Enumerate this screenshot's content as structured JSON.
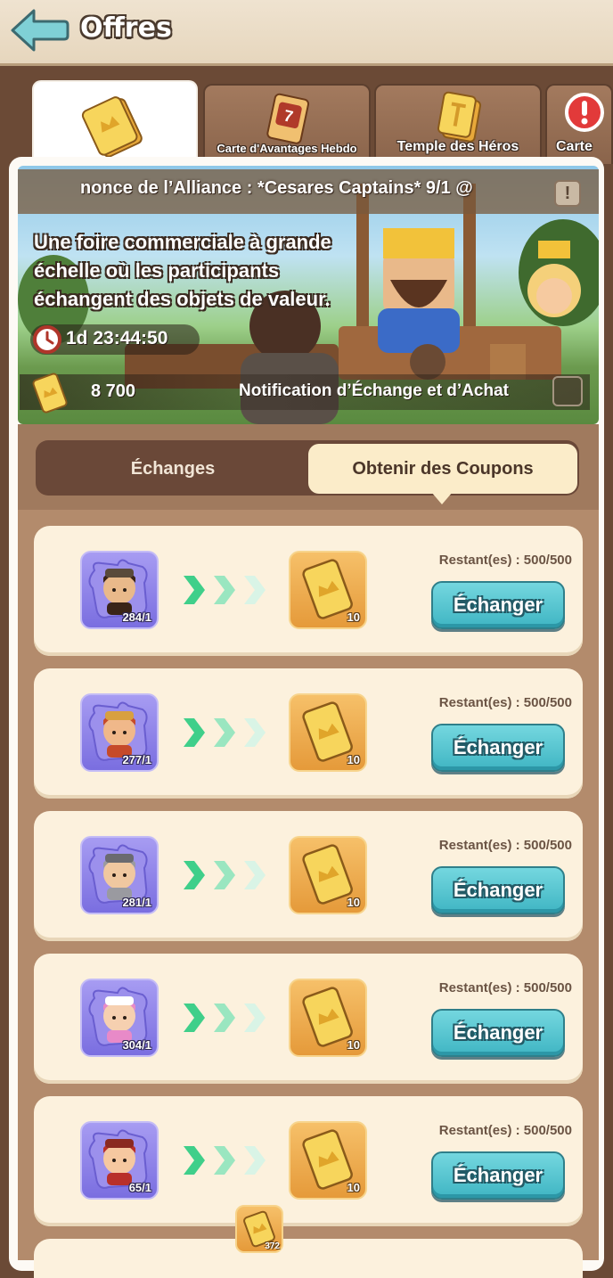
{
  "header": {
    "title": "Offres"
  },
  "tabs": [
    {
      "label": "",
      "icon": "coupon-icon",
      "active": true
    },
    {
      "label": "Carte d'Avantages Hebdo",
      "icon": "weekly-card-icon",
      "active": false
    },
    {
      "label": "Temple des Héros",
      "icon": "hero-temple-icon",
      "active": false
    },
    {
      "label": "Carte",
      "icon": "alert-icon",
      "active": false
    }
  ],
  "banner": {
    "alliance_announcement": "nonce de l’Alliance : *Cesares Captains* 9/1 @",
    "description": "Une foire commerciale à grande échelle où les participants échangent des objets de valeur.",
    "timer": "1d 23:44:50",
    "coupon_count": "8 700",
    "notification_label": "Notification d’Échange et d’Achat"
  },
  "segments": {
    "exchanges": "Échanges",
    "get_coupons": "Obtenir des Coupons",
    "active": "get_coupons"
  },
  "rows": [
    {
      "hero": "bearded-warrior",
      "hero_count": "284/1",
      "reward_count": "10",
      "remaining": "Restant(es) : 500/500",
      "button": "Échanger"
    },
    {
      "hero": "red-hat-dwarf",
      "hero_count": "277/1",
      "reward_count": "10",
      "remaining": "Restant(es) : 500/500",
      "button": "Échanger"
    },
    {
      "hero": "grey-hair-knight",
      "hero_count": "281/1",
      "reward_count": "10",
      "remaining": "Restant(es) : 500/500",
      "button": "Échanger"
    },
    {
      "hero": "pink-hair-mage",
      "hero_count": "304/1",
      "reward_count": "10",
      "remaining": "Restant(es) : 500/500",
      "button": "Échanger"
    },
    {
      "hero": "red-hair-archer",
      "hero_count": "65/1",
      "reward_count": "10",
      "remaining": "Restant(es) : 500/500",
      "button": "Échanger"
    }
  ],
  "footer": {
    "coupon_total": "372"
  },
  "colors": {
    "accent_button": "#3fb5c3",
    "frame": "#6b4a36",
    "row_bg": "#fcf1dd",
    "hero_tile": "#7a6ee0",
    "reward_tile": "#e59a3a"
  }
}
